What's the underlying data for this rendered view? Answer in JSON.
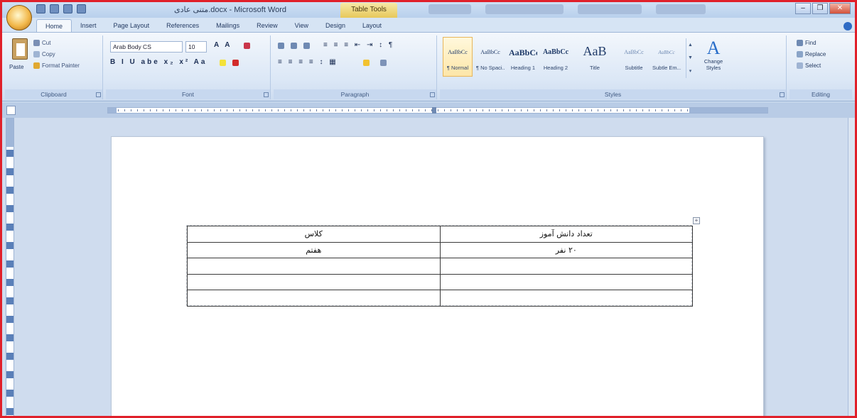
{
  "window": {
    "title": "متنی عادی.docx - Microsoft Word",
    "context_tab": "Table Tools",
    "controls": [
      "–",
      "❐",
      "✕"
    ]
  },
  "tabs": [
    {
      "label": "Home",
      "active": true
    },
    {
      "label": "Insert"
    },
    {
      "label": "Page Layout"
    },
    {
      "label": "References"
    },
    {
      "label": "Mailings"
    },
    {
      "label": "Review"
    },
    {
      "label": "View"
    },
    {
      "label": "Design"
    },
    {
      "label": "Layout"
    }
  ],
  "ribbon": {
    "clipboard": {
      "label": "Clipboard",
      "paste": "Paste",
      "cut": "Cut",
      "copy": "Copy",
      "format_painter": "Format Painter"
    },
    "font": {
      "label": "Font",
      "font_name": "Arab Body CS",
      "font_size": "10",
      "row1_glyphs": "A A",
      "row2_glyphs": "B I U abe x₂ x² Aa"
    },
    "paragraph": {
      "label": "Paragraph",
      "row1_glyphs": "≡ ≡ ≡ ⇤ ⇥ ↕ ¶",
      "row2_glyphs": "≡ ≡ ≡ ≡ ↕ ▦"
    },
    "styles": {
      "label": "Styles",
      "items": [
        {
          "preview": "AaBbCc",
          "name": "¶ Normal",
          "active": true,
          "size": 8
        },
        {
          "preview": "AaBbCc",
          "name": "¶ No Spaci...",
          "size": 8
        },
        {
          "preview": "AaBbCc",
          "name": "Heading 1",
          "size": 12
        },
        {
          "preview": "AaBbCc",
          "name": "Heading 2",
          "size": 10
        },
        {
          "preview": "AaB",
          "name": "Title",
          "size": 18
        },
        {
          "preview": "AaBbCc",
          "name": "Subtitle",
          "size": 8
        },
        {
          "preview": "AaBbCc",
          "name": "Subtle Em...",
          "size": 7
        }
      ],
      "change_styles": "Change Styles"
    },
    "editing": {
      "label": "Editing",
      "find": "Find",
      "replace": "Replace",
      "select": "Select"
    }
  },
  "document": {
    "table": {
      "rows": [
        [
          "کلاس",
          "تعداد دانش آموز"
        ],
        [
          "هفتم",
          "۲۰ نفر"
        ],
        [
          "",
          ""
        ],
        [
          "",
          ""
        ],
        [
          "",
          ""
        ]
      ]
    }
  },
  "colors": {
    "frame_border": "#e0202a",
    "ribbon_bg": "#dbe7f6",
    "workspace_bg": "#cfdcee"
  }
}
